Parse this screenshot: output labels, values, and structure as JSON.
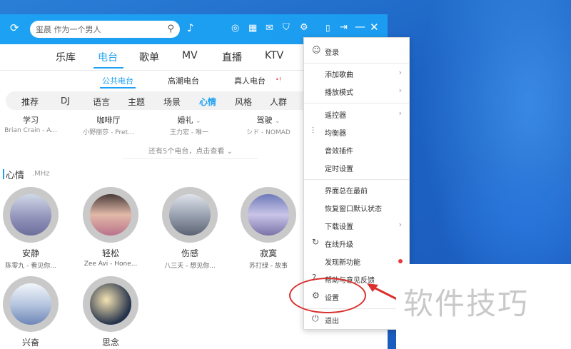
{
  "titlebar": {
    "search_text": "玺晨 作为一个男人",
    "icons": [
      "refresh-icon",
      "mic-icon",
      "radio-icon",
      "grid-icon",
      "mail-icon",
      "shirt-icon",
      "gear-icon",
      "phone-icon",
      "mini-mode-icon",
      "minimize-icon",
      "close-icon"
    ]
  },
  "nav": {
    "items": [
      "乐库",
      "电台",
      "歌单",
      "MV",
      "直播",
      "KTV"
    ],
    "active": "电台"
  },
  "subnav": {
    "items": [
      "公共电台",
      "高潮电台",
      "真人电台"
    ],
    "badge": "•!"
  },
  "categories": [
    "推荐",
    "DJ",
    "语言",
    "主题",
    "场景",
    "心情",
    "风格",
    "人群"
  ],
  "stations": [
    {
      "name": "学习",
      "sub": "Brian Crain - A..."
    },
    {
      "name": "咖啡厅",
      "sub": "小野丽莎 - Pret..."
    },
    {
      "name": "婚礼",
      "sub": "王力宏 - 唯一"
    },
    {
      "name": "驾驶",
      "sub": "シド - NOMAD"
    }
  ],
  "more_text": "还有5个电台，点击查看",
  "section": {
    "title": "心情",
    "sub": ".MHz"
  },
  "moods": [
    {
      "name": "安静",
      "sub": "陈零九 - 看见你..."
    },
    {
      "name": "轻松",
      "sub": "Zee Avi - Hone..."
    },
    {
      "name": "伤感",
      "sub": "八三夭 - 想见你..."
    },
    {
      "name": "寂寞",
      "sub": "苏打绿 - 故事"
    },
    {
      "name": "兴奋",
      "sub": ""
    },
    {
      "name": "思念",
      "sub": ""
    }
  ],
  "menu": {
    "login": "登录",
    "add_song": "添加歌曲",
    "play_mode": "播放模式",
    "remote": "遥控器",
    "equalizer": "均衡器",
    "effects": "音效插件",
    "timer": "定时设置",
    "always_top": "界面总在最前",
    "restore_window": "恢复窗口默认状态",
    "download_settings": "下载设置",
    "upgrade": "在线升级",
    "new_features": "发现新功能",
    "help": "帮助与意见反馈",
    "settings": "设置",
    "quit": "退出"
  },
  "watermark": "软件技巧",
  "colors": {
    "accent": "#1da1f2",
    "annotation": "#d9312e"
  }
}
